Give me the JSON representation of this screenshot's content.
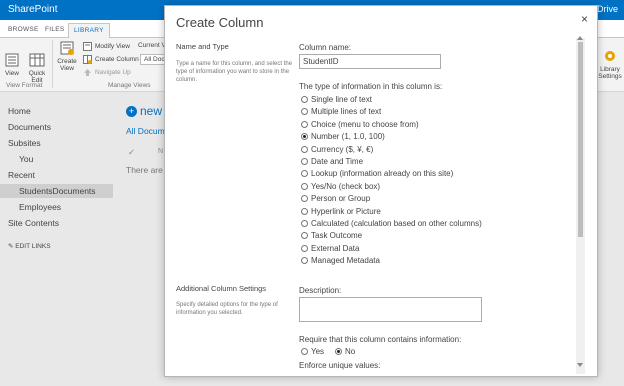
{
  "suite": {
    "brand": "SharePoint",
    "right_link": "Drive"
  },
  "ribbon": {
    "tabs": [
      "BROWSE",
      "FILES",
      "LIBRARY"
    ],
    "buttons": {
      "view": "View",
      "quick_edit": "Quick Edit",
      "create_view": "Create View",
      "modify_view": "Modify View",
      "current_view": "Current V",
      "create_column": "Create Column",
      "all_doc": "All Doc",
      "navigate_up": "Navigate Up",
      "library_settings": "Library Settings"
    },
    "groups": {
      "view_format": "View Format",
      "manage_views": "Manage Views"
    }
  },
  "leftnav": {
    "items": [
      "Home",
      "Documents",
      "Subsites",
      "You",
      "Recent",
      "StudentsDocuments",
      "Employees",
      "Site Contents"
    ],
    "edit_links": "EDIT LINKS"
  },
  "main": {
    "new_label": "new",
    "all_documents": "All Docume",
    "col_name_partial": "N",
    "empty_partial": "There are"
  },
  "dialog": {
    "title": "Create Column",
    "close": "×",
    "name_type": {
      "heading": "Name and Type",
      "desc": "Type a name for this column, and select the type of information you want to store in the column."
    },
    "column_name_label": "Column name:",
    "column_name_value": "StudentID",
    "type_prompt": "The type of information in this column is:",
    "types": [
      "Single line of text",
      "Multiple lines of text",
      "Choice (menu to choose from)",
      "Number (1, 1.0, 100)",
      "Currency ($, ¥, €)",
      "Date and Time",
      "Lookup (information already on this site)",
      "Yes/No (check box)",
      "Person or Group",
      "Hyperlink or Picture",
      "Calculated (calculation based on other columns)",
      "Task Outcome",
      "External Data",
      "Managed Metadata"
    ],
    "selected_type": "Number (1, 1.0, 100)",
    "additional": {
      "heading": "Additional Column Settings",
      "desc": "Specify detailed options for the type of information you selected."
    },
    "description_label": "Description:",
    "require_label": "Require that this column contains information:",
    "require_yes": "Yes",
    "require_no": "No",
    "require_selected": "No",
    "enforce_label": "Enforce unique values:"
  }
}
